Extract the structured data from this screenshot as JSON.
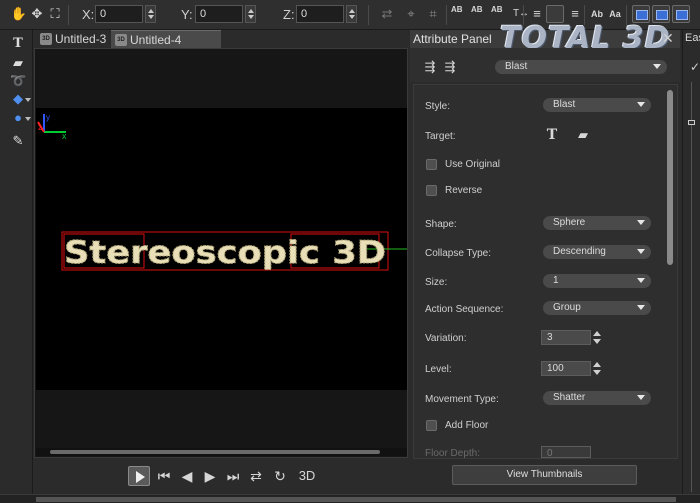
{
  "toolbar": {
    "x_label": "X:",
    "x_value": "0",
    "y_label": "Y:",
    "y_value": "0",
    "z_label": "Z:",
    "z_value": "0",
    "text_tool_1": "AB",
    "text_tool_2": "AB",
    "text_tool_3": "AB"
  },
  "tabs": [
    {
      "label": "Untitled-3",
      "active": false
    },
    {
      "label": "Untitled-4",
      "active": true
    }
  ],
  "viewport": {
    "text_object": "Stereoscopic 3D",
    "axis_colors": {
      "x": "#00cc33",
      "y": "#3355ff",
      "z": "#ff2222"
    }
  },
  "playback": {
    "mode_label": "3D"
  },
  "attribute_panel": {
    "title": "Attribute Panel",
    "logo": "TOTAL 3D",
    "effect_select": "Blast",
    "properties": {
      "style_label": "Style:",
      "style_value": "Blast",
      "target_label": "Target:",
      "use_original_label": "Use Original",
      "reverse_label": "Reverse",
      "shape_label": "Shape:",
      "shape_value": "Sphere",
      "collapse_label": "Collapse Type:",
      "collapse_value": "Descending",
      "size_label": "Size:",
      "size_value": "1",
      "action_label": "Action Sequence:",
      "action_value": "Group",
      "variation_label": "Variation:",
      "variation_value": "3",
      "level_label": "Level:",
      "level_value": "100",
      "movement_label": "Movement Type:",
      "movement_value": "Shatter",
      "add_floor_label": "Add Floor",
      "floor_depth_label": "Floor Depth:",
      "floor_depth_value": "0"
    },
    "view_thumbnails_label": "View Thumbnails"
  },
  "right_panel": {
    "tab_label": "Eas"
  }
}
